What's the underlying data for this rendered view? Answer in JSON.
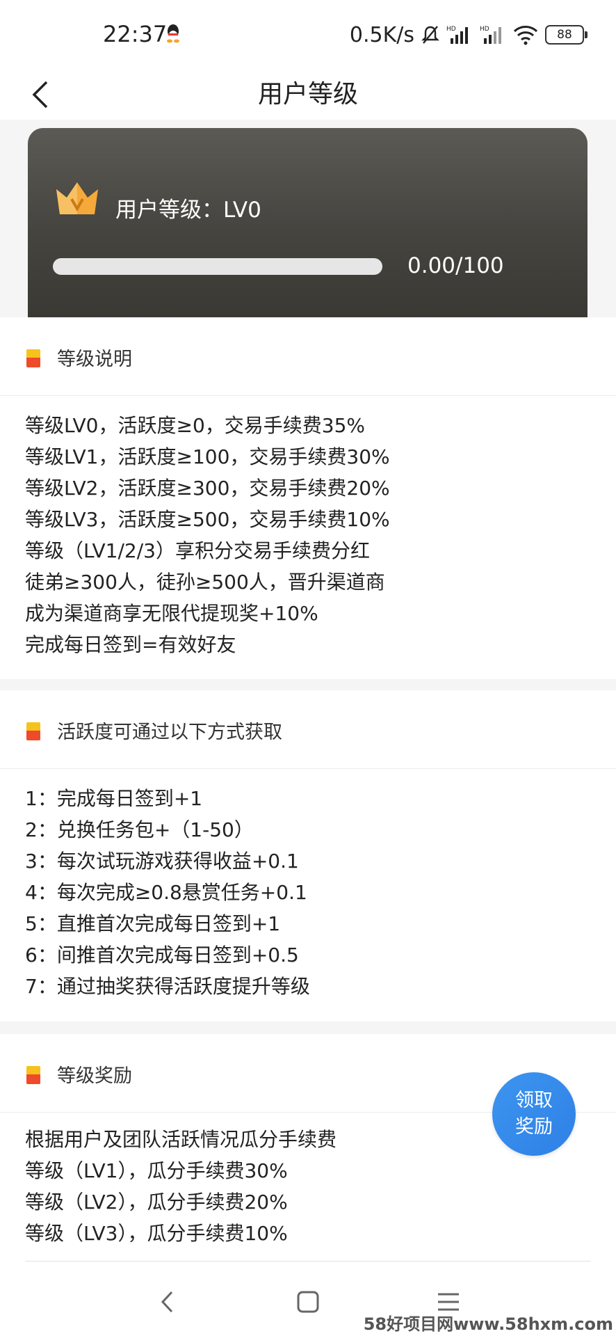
{
  "status_bar": {
    "time": "22:37",
    "net_speed": "0.5K/s",
    "battery": "88"
  },
  "header": {
    "title": "用户等级"
  },
  "level_card": {
    "label": "用户等级：LV0",
    "progress_text": "0.00/100",
    "progress_fraction": 0.0
  },
  "sections": [
    {
      "title": "等级说明",
      "lines": [
        "等级LV0，活跃度≥0，交易手续费35%",
        "等级LV1，活跃度≥100，交易手续费30%",
        "等级LV2，活跃度≥300，交易手续费20%",
        "等级LV3，活跃度≥500，交易手续费10%",
        "等级（LV1/2/3）享积分交易手续费分红",
        "徒弟≥300人，徒孙≥500人，晋升渠道商",
        "成为渠道商享无限代提现奖+10%",
        "完成每日签到=有效好友"
      ]
    },
    {
      "title": "活跃度可通过以下方式获取",
      "lines": [
        "1：完成每日签到+1",
        "2：兑换任务包+（1-50）",
        "3：每次试玩游戏获得收益+0.1",
        "4：每次完成≥0.8悬赏任务+0.1",
        "5：直推首次完成每日签到+1",
        "6：间推首次完成每日签到+0.5",
        "7：通过抽奖获得活跃度提升等级"
      ]
    },
    {
      "title": "等级奖励",
      "lines": [
        "根据用户及团队活跃情况瓜分手续费",
        "等级（LV1），瓜分手续费30%",
        "等级（LV2），瓜分手续费20%",
        "等级（LV3），瓜分手续费10%"
      ]
    }
  ],
  "claim_button": {
    "line1": "领取",
    "line2": "奖励"
  },
  "watermark": "58好项目网www.58hxm.com",
  "colors": {
    "accent_blue": "#2f80e6",
    "card_dark": "#45443f",
    "crown_orange": "#f4a93a"
  }
}
